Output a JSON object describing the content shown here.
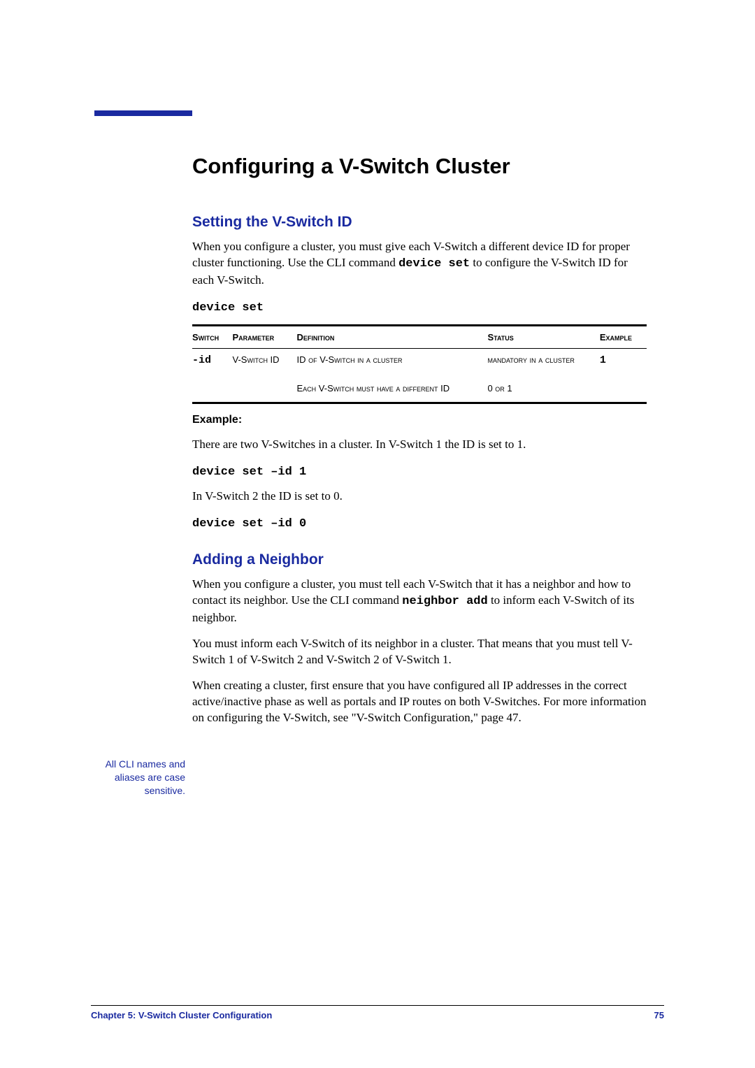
{
  "title": "Configuring a V-Switch Cluster",
  "section1": {
    "heading": "Setting the V-Switch ID",
    "para1_a": "When you configure a cluster, you must give each V-Switch a different device ID for proper cluster functioning.  Use the CLI command ",
    "cmd_inline": "device set",
    "para1_b": " to configure the V-Switch ID for each V-Switch.",
    "cmd_block": "device set",
    "table": {
      "headers": [
        "Switch",
        "Parameter",
        "Definition",
        "Status",
        "Example"
      ],
      "row": {
        "switch": "-id",
        "parameter": "V-Switch ID",
        "definition1": "ID of V-Switch in a cluster",
        "definition2": "Each V-Switch must have a different ID",
        "status1": "mandatory in a cluster",
        "status2": "0 or 1",
        "example": "1"
      }
    },
    "example_label": "Example:",
    "example_p1": "There are two V-Switches in a cluster.  In V-Switch 1 the ID is set to 1.",
    "example_cmd1": "device set –id 1",
    "example_p2": "In V-Switch 2 the ID is set to 0.",
    "example_cmd2": "device set –id 0"
  },
  "section2": {
    "heading": "Adding a Neighbor",
    "margin_note": "All CLI names and aliases are case sensitive.",
    "para1_a": "When you configure a cluster, you must tell each V-Switch that it has a neighbor and how to contact its neighbor.  Use the CLI command ",
    "cmd_inline": "neighbor add",
    "para1_b": " to inform each V-Switch of its neighbor.",
    "para2": "You must inform each V-Switch of its neighbor in a cluster.  That means that you must tell V-Switch 1 of V-Switch 2 and V-Switch 2 of V-Switch 1.",
    "para3": "When creating a cluster, first ensure that you have configured all IP addresses in the correct active/inactive phase as well as portals and IP routes on both V-Switches.  For more information on configuring the V-Switch, see \"V-Switch Configuration,\" page 47."
  },
  "footer": {
    "left": "Chapter 5:  V-Switch Cluster Configuration",
    "right": "75"
  }
}
